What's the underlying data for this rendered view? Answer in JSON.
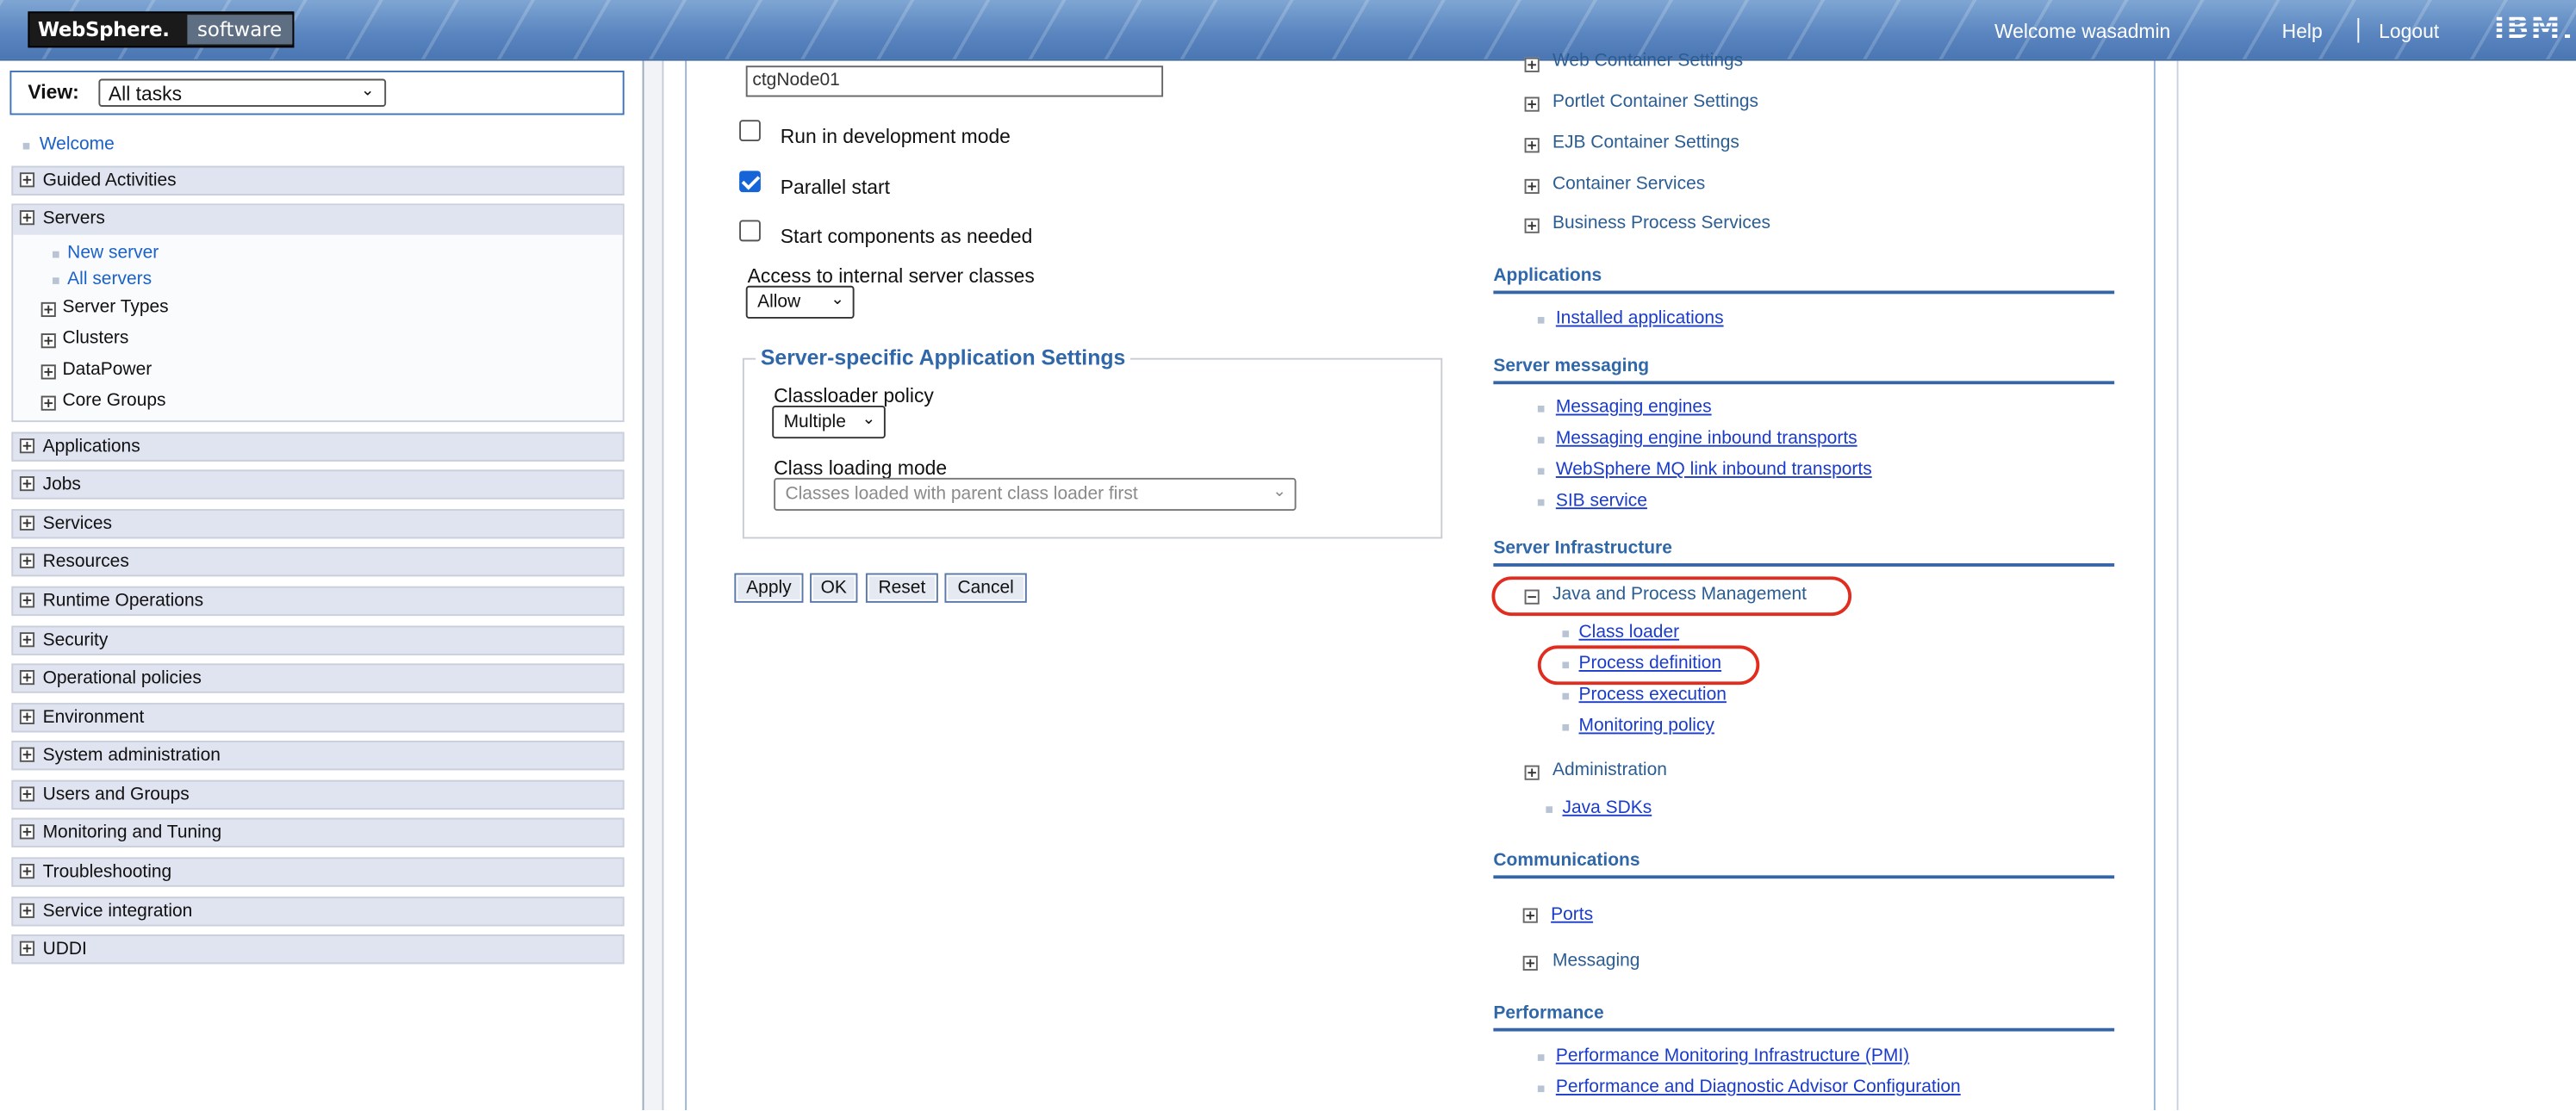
{
  "header": {
    "brand_bold": "WebSphere.",
    "brand_light": "software",
    "welcome": "Welcome wasadmin",
    "help": "Help",
    "separator": "|",
    "logout": "Logout",
    "ibm": "IBM."
  },
  "nav": {
    "view_label": "View:",
    "view_value": "All tasks",
    "welcome": "Welcome",
    "categories": [
      "Guided Activities",
      "Servers",
      "Applications",
      "Jobs",
      "Services",
      "Resources",
      "Runtime Operations",
      "Security",
      "Operational policies",
      "Environment",
      "System administration",
      "Users and Groups",
      "Monitoring and Tuning",
      "Troubleshooting",
      "Service integration",
      "UDDI"
    ],
    "servers": {
      "links": [
        "New server",
        "All servers"
      ],
      "groups": [
        "Server Types",
        "Clusters",
        "DataPower",
        "Core Groups"
      ]
    }
  },
  "form": {
    "node_value": "ctgNode01",
    "dev_mode_label": "Run in development mode",
    "dev_mode_checked": false,
    "parallel_label": "Parallel start",
    "parallel_checked": true,
    "start_components_label": "Start components as needed",
    "start_components_checked": false,
    "access_label": "Access to internal server classes",
    "access_value": "Allow",
    "fieldset_legend": "Server-specific Application Settings",
    "classloader_policy_label": "Classloader policy",
    "classloader_policy_value": "Multiple",
    "class_loading_mode_label": "Class loading mode",
    "class_loading_mode_value": "Classes loaded with parent class loader first",
    "buttons": {
      "apply": "Apply",
      "ok": "OK",
      "reset": "Reset",
      "cancel": "Cancel"
    }
  },
  "right": {
    "top_items": [
      "Web Container Settings",
      "Portlet Container Settings",
      "EJB Container Settings",
      "Container Services",
      "Business Process Services"
    ],
    "applications": {
      "title": "Applications",
      "links": [
        "Installed applications"
      ]
    },
    "messaging": {
      "title": "Server messaging",
      "links": [
        "Messaging engines",
        "Messaging engine inbound transports",
        "WebSphere MQ link inbound transports",
        "SIB service"
      ]
    },
    "infrastructure": {
      "title": "Server Infrastructure",
      "jpm": "Java and Process Management",
      "jpm_links": [
        "Class loader",
        "Process definition",
        "Process execution",
        "Monitoring policy"
      ],
      "administration": "Administration",
      "java_sdks": "Java SDKs"
    },
    "communications": {
      "title": "Communications",
      "ports": "Ports",
      "messaging": "Messaging"
    },
    "performance": {
      "title": "Performance",
      "links": [
        "Performance Monitoring Infrastructure (PMI)",
        "Performance and Diagnostic Advisor Configuration"
      ]
    }
  },
  "colors": {
    "header": "#5b86c0",
    "link": "#1a3cc9",
    "section": "#2f67a8",
    "highlight": "#e02d1f"
  }
}
